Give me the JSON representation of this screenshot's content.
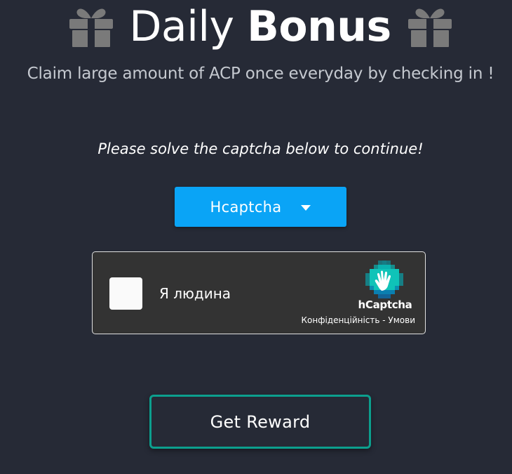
{
  "header": {
    "title_regular": "Daily",
    "title_bold": "Bonus",
    "subtitle": "Claim large amount of ACP once everyday by checking in !",
    "icon": "gift-icon"
  },
  "captcha_section": {
    "instruction": "Please solve the captcha below to continue!",
    "provider_select": {
      "selected": "Hcaptcha",
      "icon": "caret-down-icon"
    },
    "widget": {
      "checkbox_label": "Я людина",
      "brand": "hCaptcha",
      "privacy_link": "Конфіденційність",
      "separator": " - ",
      "terms_link": "Умови"
    }
  },
  "actions": {
    "get_reward_label": "Get Reward"
  },
  "colors": {
    "background": "#262a36",
    "select_accent": "#0aa4f6",
    "reward_border": "#0c9f8e",
    "widget_background": "#333333",
    "gift_gray": "#7a7a7a"
  }
}
